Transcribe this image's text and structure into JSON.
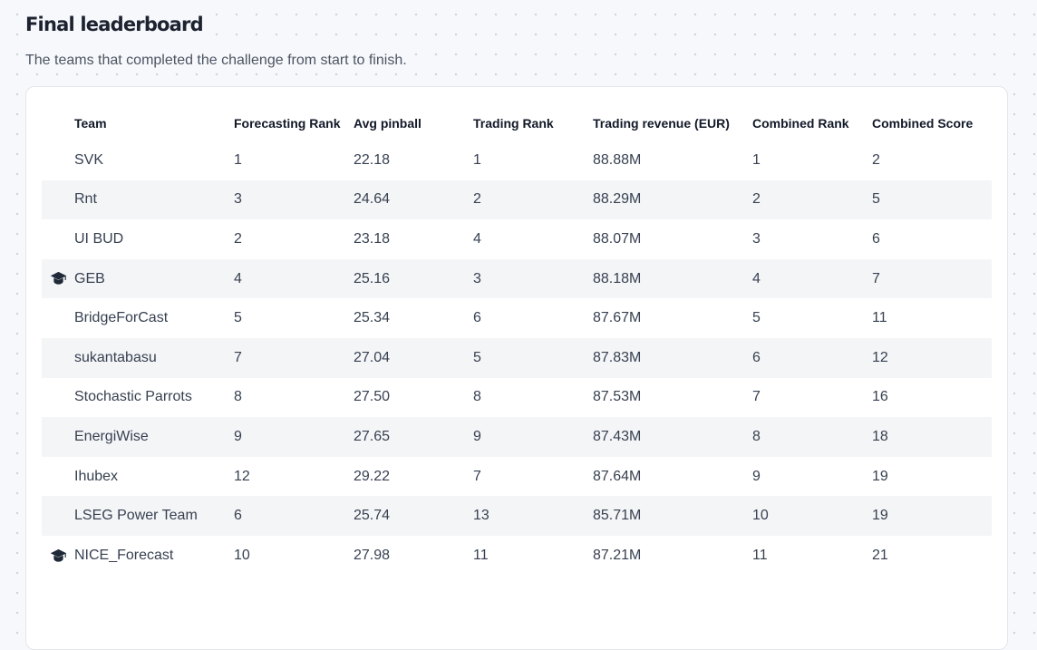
{
  "page": {
    "title": "Final leaderboard",
    "subtitle": "The teams that completed the challenge from start to finish."
  },
  "table": {
    "columns": [
      "Team",
      "Forecasting Rank",
      "Avg pinball",
      "Trading Rank",
      "Trading revenue (EUR)",
      "Combined Rank",
      "Combined Score"
    ],
    "rows": [
      {
        "icon": "",
        "team": "SVK",
        "forecasting_rank": "1",
        "avg_pinball": "22.18",
        "trading_rank": "1",
        "trading_revenue": "88.88M",
        "combined_rank": "1",
        "combined_score": "2"
      },
      {
        "icon": "",
        "team": "Rnt",
        "forecasting_rank": "3",
        "avg_pinball": "24.64",
        "trading_rank": "2",
        "trading_revenue": "88.29M",
        "combined_rank": "2",
        "combined_score": "5"
      },
      {
        "icon": "",
        "team": "UI BUD",
        "forecasting_rank": "2",
        "avg_pinball": "23.18",
        "trading_rank": "4",
        "trading_revenue": "88.07M",
        "combined_rank": "3",
        "combined_score": "6"
      },
      {
        "icon": "graduation-cap-icon",
        "team": "GEB",
        "forecasting_rank": "4",
        "avg_pinball": "25.16",
        "trading_rank": "3",
        "trading_revenue": "88.18M",
        "combined_rank": "4",
        "combined_score": "7"
      },
      {
        "icon": "",
        "team": "BridgeForCast",
        "forecasting_rank": "5",
        "avg_pinball": "25.34",
        "trading_rank": "6",
        "trading_revenue": "87.67M",
        "combined_rank": "5",
        "combined_score": "11"
      },
      {
        "icon": "",
        "team": "sukantabasu",
        "forecasting_rank": "7",
        "avg_pinball": "27.04",
        "trading_rank": "5",
        "trading_revenue": "87.83M",
        "combined_rank": "6",
        "combined_score": "12"
      },
      {
        "icon": "",
        "team": "Stochastic Parrots",
        "forecasting_rank": "8",
        "avg_pinball": "27.50",
        "trading_rank": "8",
        "trading_revenue": "87.53M",
        "combined_rank": "7",
        "combined_score": "16"
      },
      {
        "icon": "",
        "team": "EnergiWise",
        "forecasting_rank": "9",
        "avg_pinball": "27.65",
        "trading_rank": "9",
        "trading_revenue": "87.43M",
        "combined_rank": "8",
        "combined_score": "18"
      },
      {
        "icon": "",
        "team": "Ihubex",
        "forecasting_rank": "12",
        "avg_pinball": "29.22",
        "trading_rank": "7",
        "trading_revenue": "87.64M",
        "combined_rank": "9",
        "combined_score": "19"
      },
      {
        "icon": "",
        "team": "LSEG Power Team",
        "forecasting_rank": "6",
        "avg_pinball": "25.74",
        "trading_rank": "13",
        "trading_revenue": "85.71M",
        "combined_rank": "10",
        "combined_score": "19"
      },
      {
        "icon": "graduation-cap-icon",
        "team": "NICE_Forecast",
        "forecasting_rank": "10",
        "avg_pinball": "27.98",
        "trading_rank": "11",
        "trading_revenue": "87.21M",
        "combined_rank": "11",
        "combined_score": "21"
      }
    ]
  },
  "colors": {
    "background": "#f7f8fb",
    "card": "#ffffff",
    "stripe": "#f4f5f7",
    "icon": "#1f2937"
  }
}
